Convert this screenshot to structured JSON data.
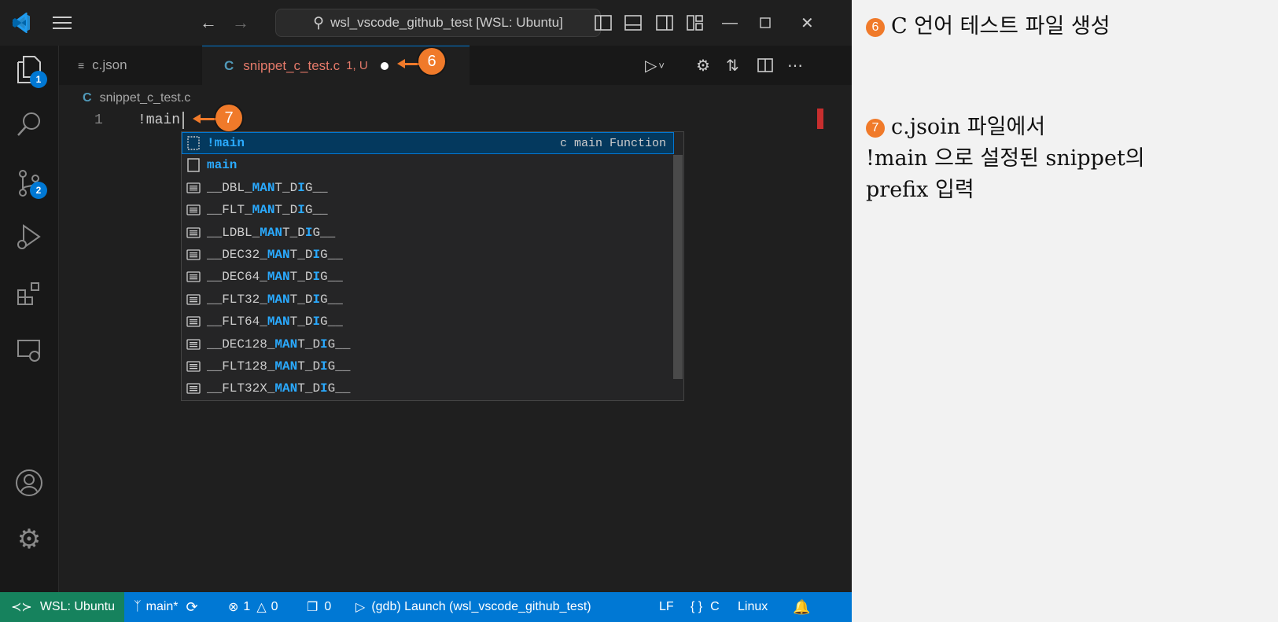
{
  "titlebar": {
    "search_text": "wsl_vscode_github_test [WSL: Ubuntu]"
  },
  "activity": {
    "explorer_badge": "1",
    "scm_badge": "2"
  },
  "tabs": {
    "json_label": "c.json",
    "c_label": "snippet_c_test.c",
    "c_status": "1, U",
    "c_glyph": "C"
  },
  "breadcrumb": {
    "glyph": "C",
    "file": "snippet_c_test.c"
  },
  "editor": {
    "line_number": "1",
    "code": "!main"
  },
  "suggest": {
    "items": [
      {
        "parts": [
          {
            "t": "!main",
            "h": true
          }
        ],
        "detail": "c main Function",
        "kind": "snippet"
      },
      {
        "parts": [
          {
            "t": "main",
            "h": true
          }
        ],
        "detail": "",
        "kind": "snippet"
      },
      {
        "parts": [
          {
            "t": "__DBL_",
            "h": false
          },
          {
            "t": "MAN",
            "h": true
          },
          {
            "t": "T_D",
            "h": false
          },
          {
            "t": "I",
            "h": true
          },
          {
            "t": "G__",
            "h": false
          }
        ],
        "detail": "",
        "kind": "text"
      },
      {
        "parts": [
          {
            "t": "__FLT_",
            "h": false
          },
          {
            "t": "MAN",
            "h": true
          },
          {
            "t": "T_D",
            "h": false
          },
          {
            "t": "I",
            "h": true
          },
          {
            "t": "G__",
            "h": false
          }
        ],
        "detail": "",
        "kind": "text"
      },
      {
        "parts": [
          {
            "t": "__LDBL_",
            "h": false
          },
          {
            "t": "MAN",
            "h": true
          },
          {
            "t": "T_D",
            "h": false
          },
          {
            "t": "I",
            "h": true
          },
          {
            "t": "G__",
            "h": false
          }
        ],
        "detail": "",
        "kind": "text"
      },
      {
        "parts": [
          {
            "t": "__DEC32_",
            "h": false
          },
          {
            "t": "MAN",
            "h": true
          },
          {
            "t": "T_D",
            "h": false
          },
          {
            "t": "I",
            "h": true
          },
          {
            "t": "G__",
            "h": false
          }
        ],
        "detail": "",
        "kind": "text"
      },
      {
        "parts": [
          {
            "t": "__DEC64_",
            "h": false
          },
          {
            "t": "MAN",
            "h": true
          },
          {
            "t": "T_D",
            "h": false
          },
          {
            "t": "I",
            "h": true
          },
          {
            "t": "G__",
            "h": false
          }
        ],
        "detail": "",
        "kind": "text"
      },
      {
        "parts": [
          {
            "t": "__FLT32_",
            "h": false
          },
          {
            "t": "MAN",
            "h": true
          },
          {
            "t": "T_D",
            "h": false
          },
          {
            "t": "I",
            "h": true
          },
          {
            "t": "G__",
            "h": false
          }
        ],
        "detail": "",
        "kind": "text"
      },
      {
        "parts": [
          {
            "t": "__FLT64_",
            "h": false
          },
          {
            "t": "MAN",
            "h": true
          },
          {
            "t": "T_D",
            "h": false
          },
          {
            "t": "I",
            "h": true
          },
          {
            "t": "G__",
            "h": false
          }
        ],
        "detail": "",
        "kind": "text"
      },
      {
        "parts": [
          {
            "t": "__DEC128_",
            "h": false
          },
          {
            "t": "MAN",
            "h": true
          },
          {
            "t": "T_D",
            "h": false
          },
          {
            "t": "I",
            "h": true
          },
          {
            "t": "G__",
            "h": false
          }
        ],
        "detail": "",
        "kind": "text"
      },
      {
        "parts": [
          {
            "t": "__FLT128_",
            "h": false
          },
          {
            "t": "MAN",
            "h": true
          },
          {
            "t": "T_D",
            "h": false
          },
          {
            "t": "I",
            "h": true
          },
          {
            "t": "G__",
            "h": false
          }
        ],
        "detail": "",
        "kind": "text"
      },
      {
        "parts": [
          {
            "t": "__FLT32X_",
            "h": false
          },
          {
            "t": "MAN",
            "h": true
          },
          {
            "t": "T_D",
            "h": false
          },
          {
            "t": "I",
            "h": true
          },
          {
            "t": "G__",
            "h": false
          }
        ],
        "detail": "",
        "kind": "text"
      }
    ]
  },
  "statusbar": {
    "remote": "WSL: Ubuntu",
    "branch": "main*",
    "errors": "1",
    "warnings": "0",
    "ports": "0",
    "debug": "(gdb) Launch (wsl_vscode_github_test)",
    "eol": "LF",
    "language": "C",
    "platform": "Linux"
  },
  "callouts": {
    "six": "6",
    "seven": "7"
  },
  "notes": {
    "n6_num": "6",
    "n6_text": "C 언어 테스트 파일 생성",
    "n7_num": "7",
    "n7_line1": "c.jsoin 파일에서",
    "n7_line2": "!main 으로 설정된 snippet의",
    "n7_line3": "prefix 입력"
  },
  "colors": {
    "accent": "#0078d4",
    "remote": "#16825d",
    "callout": "#f07a2a",
    "modified_tab": "#e57a6a",
    "match_highlight": "#2aaaff"
  }
}
